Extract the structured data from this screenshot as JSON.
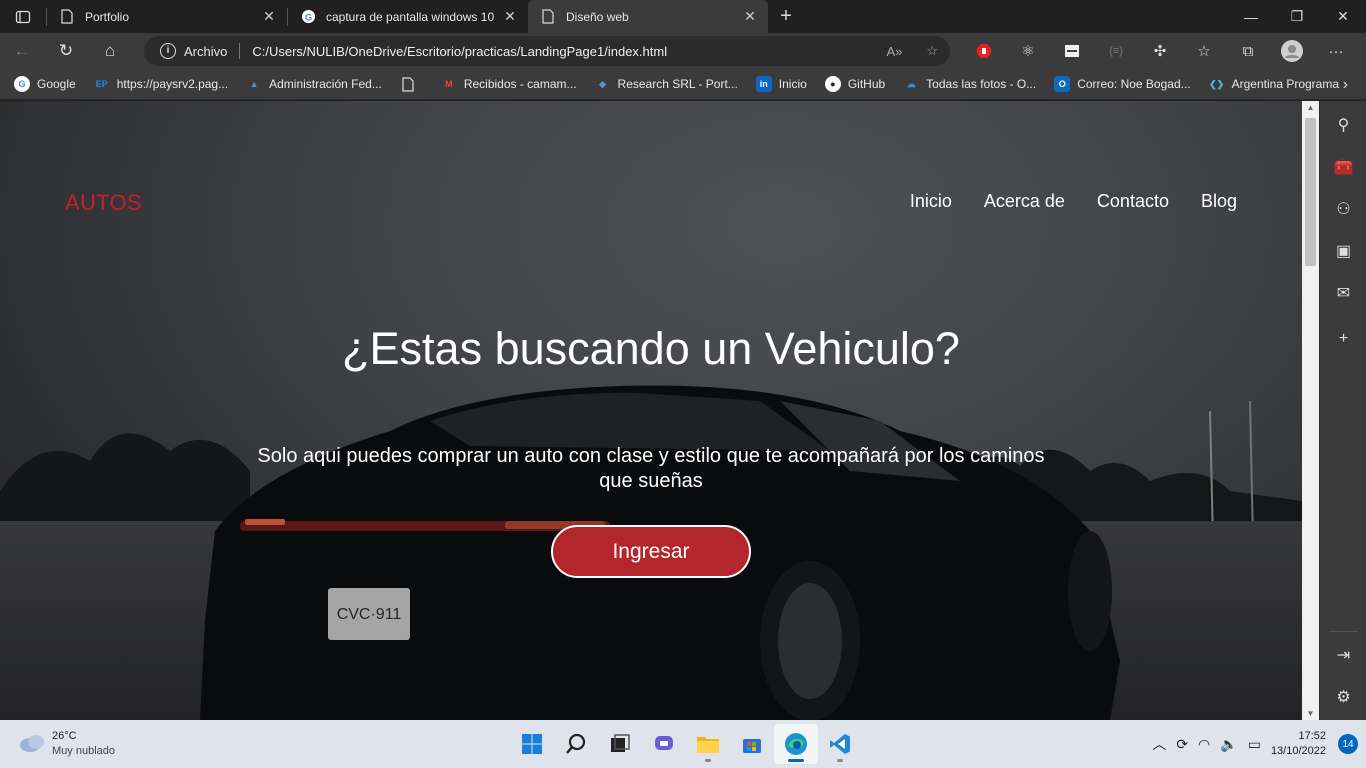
{
  "browser": {
    "tabs": [
      {
        "title": "Portfolio",
        "icon": "page-icon",
        "active": false
      },
      {
        "title": "captura de pantalla windows 10",
        "icon": "google-icon",
        "active": false
      },
      {
        "title": "Diseño web",
        "icon": "page-icon",
        "active": true
      }
    ],
    "address": {
      "scheme_label": "Archivo",
      "url": "C:/Users/NULIB/OneDrive/Escritorio/practicas/LandingPage1/index.html"
    },
    "bookmarks": [
      {
        "label": "Google",
        "icon": "google-icon",
        "color": "#ffffff"
      },
      {
        "label": "https://paysrv2.pag...",
        "icon": "ep-icon",
        "color": "#1e88e5"
      },
      {
        "label": "Administración Fed...",
        "icon": "afip-icon",
        "color": "#4a90e2"
      },
      {
        "label": "",
        "icon": "page-icon",
        "color": "#cccccc"
      },
      {
        "label": "Recibidos - camam...",
        "icon": "gmail-icon",
        "color": "#ea4335"
      },
      {
        "label": "Research SRL - Port...",
        "icon": "research-icon",
        "color": "#2b5fa8"
      },
      {
        "label": "Inicio",
        "icon": "linkedin-icon",
        "color": "#0a66c2"
      },
      {
        "label": "GitHub",
        "icon": "github-icon",
        "color": "#ffffff"
      },
      {
        "label": "Todas las fotos - O...",
        "icon": "onedrive-icon",
        "color": "#2f8fe0"
      },
      {
        "label": "Correo: Noe Bogad...",
        "icon": "outlook-icon",
        "color": "#0f6cbd"
      },
      {
        "label": "Argentina Programa",
        "icon": "argprog-icon",
        "color": "#47b6e8"
      }
    ]
  },
  "page": {
    "brand": "AUTOS",
    "nav": [
      "Inicio",
      "Acerca de",
      "Contacto",
      "Blog"
    ],
    "hero_title": "¿Estas buscando un Vehiculo?",
    "hero_subtitle": "Solo aqui puedes comprar un auto con clase y estilo que te acompañará por los caminos que sueñas",
    "cta_label": "Ingresar",
    "colors": {
      "brand": "#c4202c",
      "cta": "#b3262b"
    }
  },
  "taskbar": {
    "weather_temp": "26°C",
    "weather_desc": "Muy nublado",
    "time": "17:52",
    "date": "13/10/2022",
    "notifications": "14",
    "apps": [
      "start-icon",
      "search-icon",
      "task-view-icon",
      "chat-icon",
      "file-explorer-icon",
      "store-icon",
      "edge-icon",
      "vscode-icon"
    ]
  }
}
